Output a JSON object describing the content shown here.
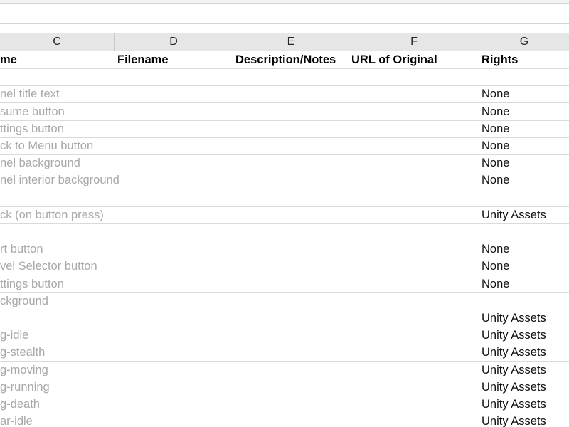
{
  "columns": [
    "C",
    "D",
    "E",
    "F",
    "G"
  ],
  "header": {
    "c": "me",
    "d": "Filename",
    "e": "Description/Notes",
    "f": "URL of Original",
    "g": "Rights"
  },
  "rows": [
    {
      "c": "",
      "g": ""
    },
    {
      "c": "nel title text",
      "g": "None"
    },
    {
      "c": "sume button",
      "g": "None"
    },
    {
      "c": "ttings button",
      "g": "None"
    },
    {
      "c": "ck to Menu button",
      "g": "None"
    },
    {
      "c": "nel background",
      "g": "None"
    },
    {
      "c": "nel interior background",
      "g": "None"
    },
    {
      "c": "",
      "g": ""
    },
    {
      "c": "ck (on button press)",
      "g": "Unity Assets"
    },
    {
      "c": "",
      "g": ""
    },
    {
      "c": "rt button",
      "g": "None"
    },
    {
      "c": "vel Selector button",
      "g": "None"
    },
    {
      "c": "ttings button",
      "g": "None"
    },
    {
      "c": "ckground",
      "g": ""
    },
    {
      "c": "",
      "g": "Unity Assets"
    },
    {
      "c": "g-idle",
      "g": "Unity Assets"
    },
    {
      "c": "g-stealth",
      "g": "Unity Assets"
    },
    {
      "c": "g-moving",
      "g": "Unity Assets"
    },
    {
      "c": "g-running",
      "g": "Unity Assets"
    },
    {
      "c": "g-death",
      "g": "Unity Assets"
    },
    {
      "c": "ar-idle",
      "g": "Unity Assets"
    }
  ]
}
